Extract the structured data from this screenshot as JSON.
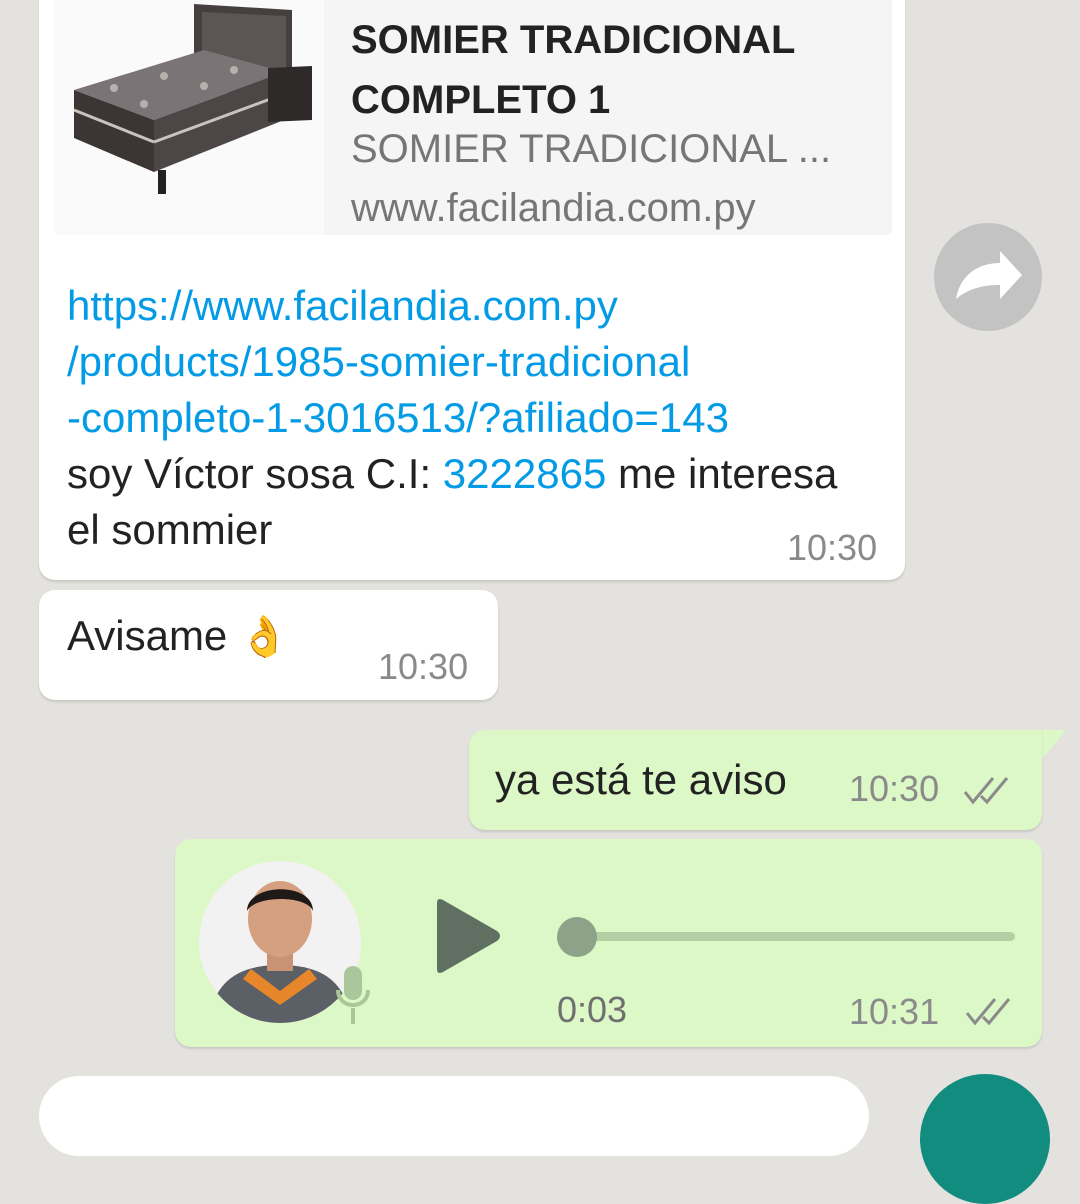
{
  "messages": {
    "link_message": {
      "preview": {
        "title": "SOMIER TRADICIONAL COMPLETO 1",
        "description": "SOMIER TRADICIONAL ...",
        "domain": "www.facilandia.com.py"
      },
      "link_lines": [
        "https://www.facilandia.com.py",
        "/products/1985-somier-tradicional",
        "-completo-1-3016513/?afiliado=143"
      ],
      "text_before_id": "soy Víctor sosa C.I: ",
      "id_number": "3222865",
      "text_after_id": " me interesa el sommier",
      "time": "10:30"
    },
    "avisame": {
      "text": "Avisame",
      "emoji": "👌",
      "time": "10:30"
    },
    "reply": {
      "text": "ya está te aviso",
      "time": "10:30",
      "status": "read"
    },
    "voice": {
      "duration": "0:03",
      "time": "10:31",
      "status": "read",
      "progress": 0
    }
  },
  "icons": {
    "forward": "forward-icon",
    "play": "play-icon",
    "mic": "mic-icon",
    "double_check": "double-check-icon"
  },
  "colors": {
    "chat_bg": "#e4e2df",
    "incoming": "#ffffff",
    "outgoing": "#dcf8c6",
    "link": "#039be5",
    "send_button": "#128c7e"
  }
}
